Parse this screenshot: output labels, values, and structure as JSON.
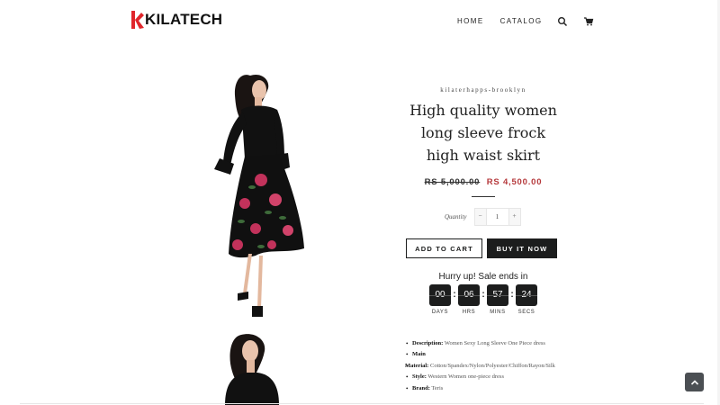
{
  "brand": {
    "name": "KILATECH",
    "logo_icon": "k-logo-icon",
    "accent": "#e0262b"
  },
  "nav": {
    "items": [
      {
        "label": "HOME"
      },
      {
        "label": "CATALOG"
      }
    ],
    "icons": [
      "search-icon",
      "cart-icon"
    ]
  },
  "product": {
    "vendor": "kilaterhapps-brooklyn",
    "title": "High quality women long sleeve frock high waist skirt",
    "price_old": "RS 5,000.00",
    "price_new": "RS 4,500.00",
    "price_new_color": "#b5383b",
    "quantity_label": "Quantity",
    "quantity_value": "1",
    "add_to_cart": "ADD TO CART",
    "buy_now": "BUY IT NOW"
  },
  "countdown": {
    "heading": "Hurry up! Sale ends in",
    "units": [
      {
        "value": "00",
        "label": "DAYS"
      },
      {
        "value": "06",
        "label": "HRS"
      },
      {
        "value": "57",
        "label": "MINS"
      },
      {
        "value": "24",
        "label": "SECS"
      }
    ]
  },
  "description": [
    {
      "key": "Description:",
      "value": "Women Sexy Long Sleeve One Piece dress"
    },
    {
      "key": "Main",
      "value": ""
    },
    {
      "key": "Material:",
      "value": "Cotton/Spandex/Nylon/Polyester/Chiffon/Rayon/Silk"
    },
    {
      "key": "Style:",
      "value": "Western Women one-piece dress"
    },
    {
      "key": "Brand:",
      "value": "Teris"
    }
  ],
  "scroll_top_icon": "chevron-up-icon"
}
